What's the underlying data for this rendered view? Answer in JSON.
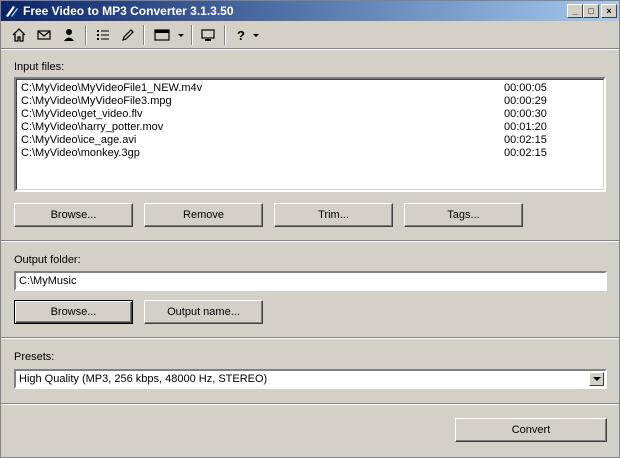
{
  "window": {
    "title": "Free Video to MP3 Converter 3.1.3.50"
  },
  "titlebar_buttons": {
    "minimize": "_",
    "maximize": "□",
    "close": "×"
  },
  "toolbar": {
    "icons": [
      "home-icon",
      "email-icon",
      "user-icon",
      "list-icon",
      "pencil-icon",
      "window-dropdown-icon",
      "monitor-icon",
      "help-dropdown-icon"
    ],
    "help_label": "?"
  },
  "input": {
    "label": "Input files:",
    "files": [
      {
        "path": "C:\\MyVideo\\MyVideoFile1_NEW.m4v",
        "duration": "00:00:05"
      },
      {
        "path": "C:\\MyVideo\\MyVideoFile3.mpg",
        "duration": "00:00:29"
      },
      {
        "path": "C:\\MyVideo\\get_video.flv",
        "duration": "00:00:30"
      },
      {
        "path": "C:\\MyVideo\\harry_potter.mov",
        "duration": "00:01:20"
      },
      {
        "path": "C:\\MyVideo\\ice_age.avi",
        "duration": "00:02:15"
      },
      {
        "path": "C:\\MyVideo\\monkey.3gp",
        "duration": "00:02:15"
      }
    ],
    "buttons": {
      "browse": "Browse...",
      "remove": "Remove",
      "trim": "Trim...",
      "tags": "Tags..."
    }
  },
  "output": {
    "label": "Output folder:",
    "folder": "C:\\MyMusic",
    "buttons": {
      "browse": "Browse...",
      "output_name": "Output name..."
    }
  },
  "presets": {
    "label": "Presets:",
    "selected": "High Quality (MP3, 256 kbps, 48000 Hz, STEREO)"
  },
  "convert_label": "Convert",
  "colors": {
    "title_start": "#0a246a",
    "title_end": "#a6caf0",
    "face": "#d4d0c8"
  }
}
